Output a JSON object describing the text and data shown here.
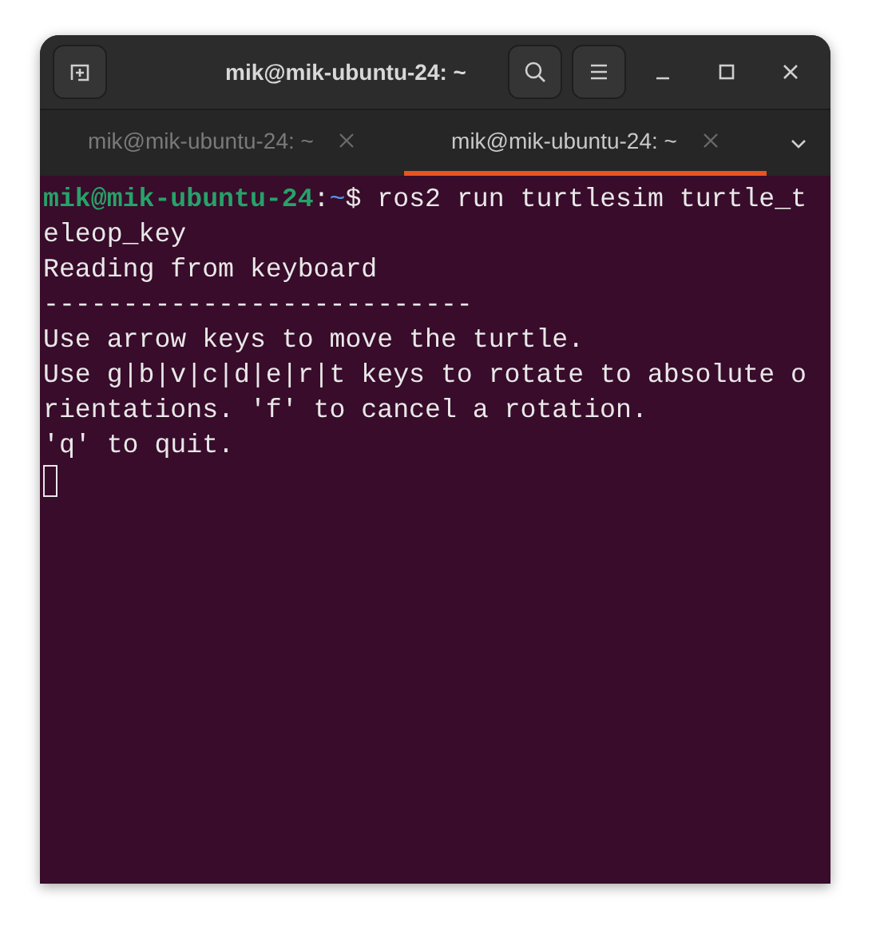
{
  "window": {
    "title": "mik@mik-ubuntu-24: ~"
  },
  "tabs": [
    {
      "label": "mik@mik-ubuntu-24: ~",
      "selected": false
    },
    {
      "label": "mik@mik-ubuntu-24: ~",
      "selected": true
    }
  ],
  "terminal": {
    "lines": [
      {
        "kind": "prompt",
        "user_host": "mik@mik-ubuntu-24",
        "separator": ":",
        "path": "~",
        "symbol": "$",
        "command": " ros2 run turtlesim turtle_t"
      },
      {
        "kind": "output",
        "text": "eleop_key"
      },
      {
        "kind": "output",
        "text": "Reading from keyboard"
      },
      {
        "kind": "output",
        "text": "---------------------------"
      },
      {
        "kind": "output",
        "text": "Use arrow keys to move the turtle."
      },
      {
        "kind": "output",
        "text": "Use g|b|v|c|d|e|r|t keys to rotate to absolute o"
      },
      {
        "kind": "output",
        "text": "rientations. 'f' to cancel a rotation."
      },
      {
        "kind": "output",
        "text": "'q' to quit."
      },
      {
        "kind": "cursor"
      }
    ]
  }
}
